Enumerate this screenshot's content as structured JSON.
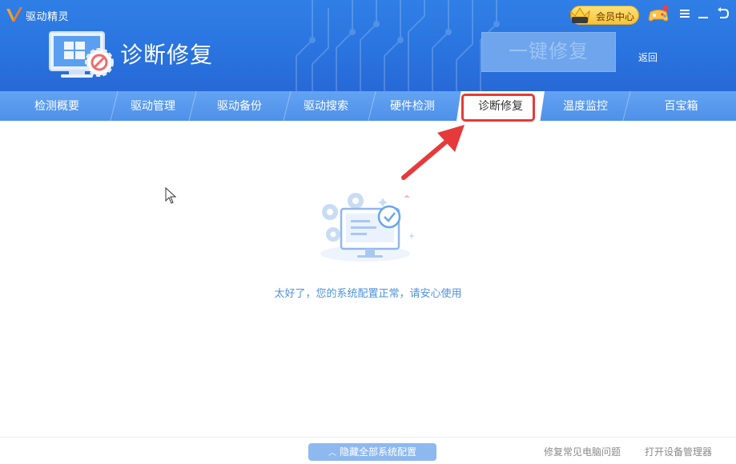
{
  "app": {
    "name": "驱动精灵"
  },
  "header": {
    "vip_label": "会员中心",
    "vip_badge": "VIP",
    "title": "诊断修复",
    "oneclick_label": "一键修复",
    "back_label": "返回"
  },
  "tabs": [
    {
      "label": "检测概要",
      "active": false
    },
    {
      "label": "驱动管理",
      "active": false
    },
    {
      "label": "驱动备份",
      "active": false
    },
    {
      "label": "驱动搜索",
      "active": false
    },
    {
      "label": "硬件检测",
      "active": false
    },
    {
      "label": "诊断修复",
      "active": true
    },
    {
      "label": "温度监控",
      "active": false
    },
    {
      "label": "百宝箱",
      "active": false
    }
  ],
  "main": {
    "status_message": "太好了，您的系统配置正常，请安心使用"
  },
  "footer": {
    "hide_all_label": "隐藏全部系统配置",
    "fix_common_label": "修复常见电脑问题",
    "open_device_manager_label": "打开设备管理器"
  },
  "colors": {
    "header_blue": "#2a74df",
    "tab_blue": "#5a9bf0",
    "highlight_red": "#e63a3a",
    "message_blue": "#4d91df",
    "vip_gold": "#f6c23a"
  },
  "icons": [
    "app-logo-icon",
    "vip-crown-icon",
    "gamepad-icon",
    "menu-icon",
    "minimize-icon",
    "back-icon",
    "diagnose-computer-icon",
    "monitor-check-icon",
    "chevron-up-icon",
    "arrow-pointer-icon",
    "mouse-cursor-icon"
  ]
}
